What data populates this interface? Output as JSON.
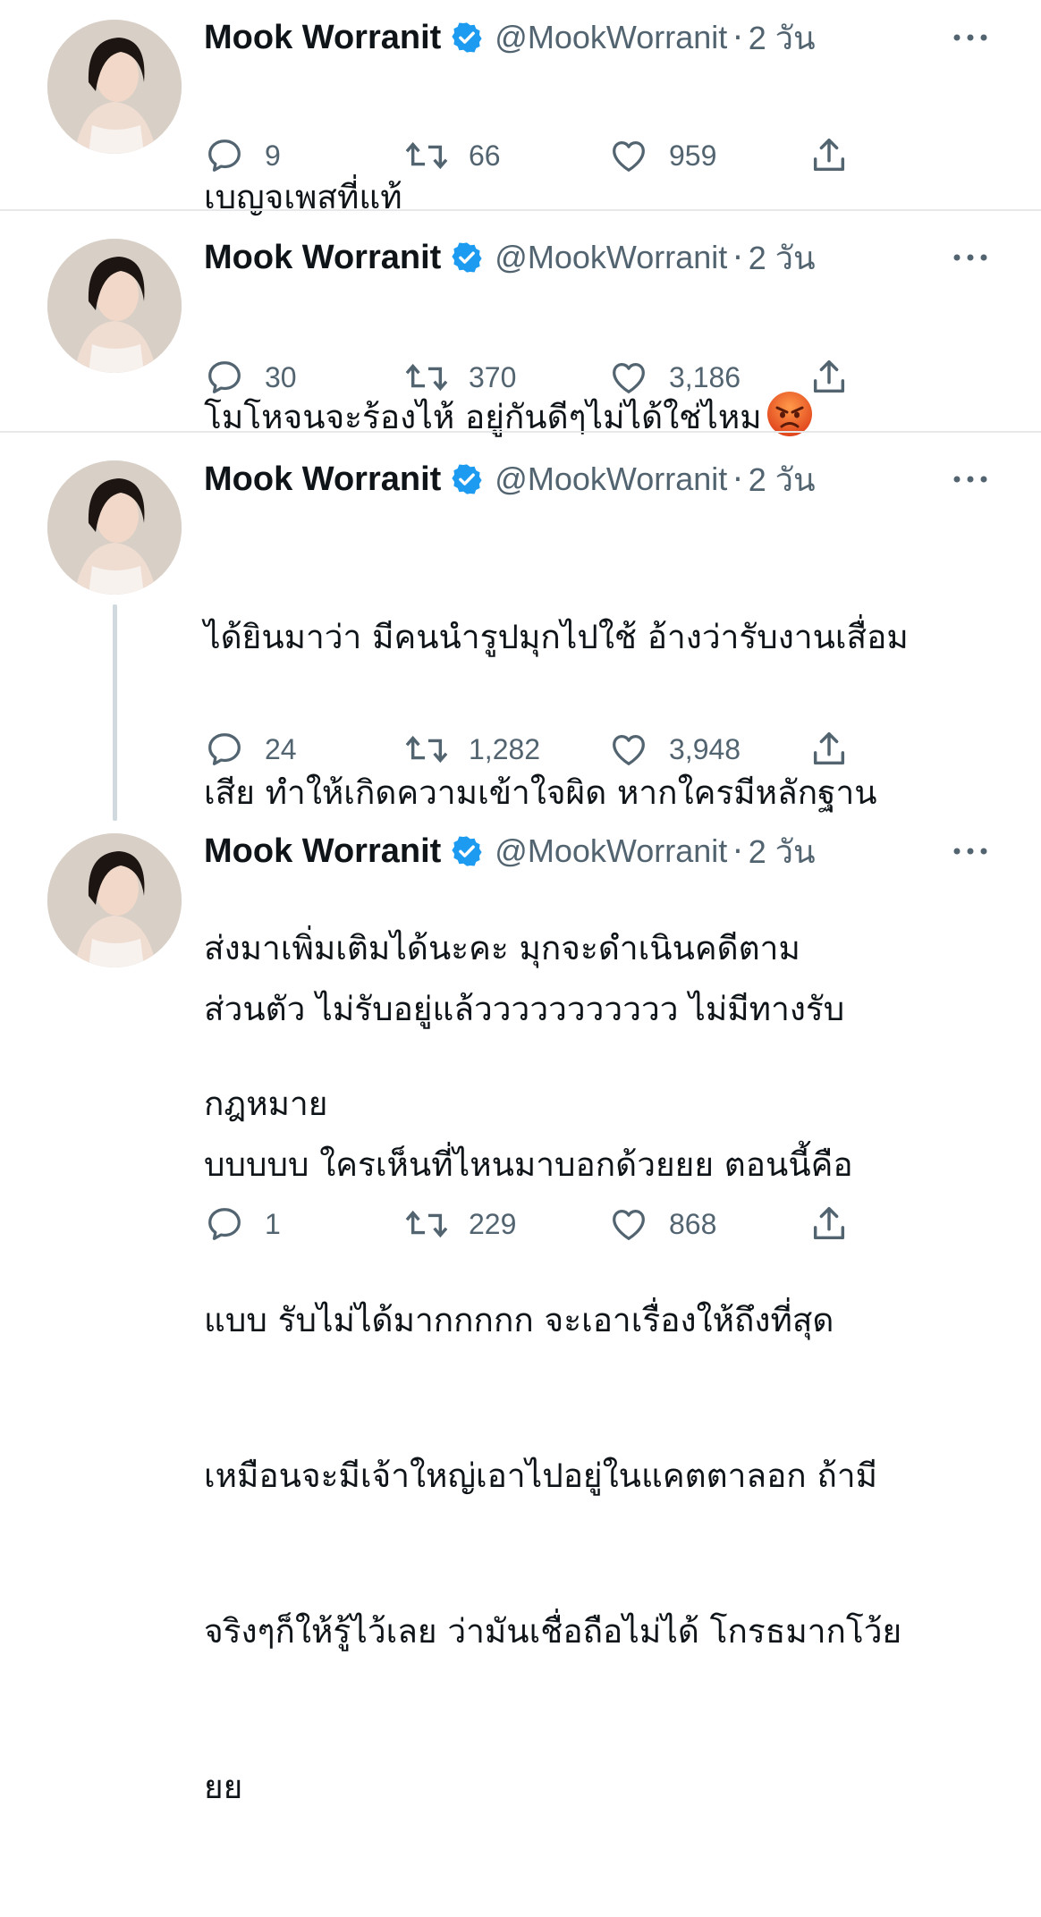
{
  "tweets": [
    {
      "name": "Mook Worranit",
      "handle": "@MookWorranit",
      "dot": "·",
      "time": "2 วัน",
      "lines": [
        "เบญจเพสที่แท้"
      ],
      "emoji": "",
      "replies": "9",
      "retweets": "66",
      "likes": "959"
    },
    {
      "name": "Mook Worranit",
      "handle": "@MookWorranit",
      "dot": "·",
      "time": "2 วัน",
      "lines": [
        "โมโหจนจะร้องไห้ อยู่กันดีๆไม่ได้ใช่ไหม"
      ],
      "emoji": "angry-face-emoji",
      "replies": "30",
      "retweets": "370",
      "likes": "3,186"
    },
    {
      "name": "Mook Worranit",
      "handle": "@MookWorranit",
      "dot": "·",
      "time": "2 วัน",
      "lines": [
        "ได้ยินมาว่า มีคนนำรูปมุกไปใช้ อ้างว่ารับงานเสื่อม",
        "เสีย ทำให้เกิดความเข้าใจผิด หากใครมีหลักฐาน",
        "ส่งมาเพิ่มเติมได้นะคะ มุกจะดำเนินคดีตาม",
        "กฎหมาย"
      ],
      "emoji": "",
      "replies": "24",
      "retweets": "1,282",
      "likes": "3,948"
    },
    {
      "name": "Mook Worranit",
      "handle": "@MookWorranit",
      "dot": "·",
      "time": "2 วัน",
      "lines": [
        "ส่วนตัว ไม่รับอยู่แล้ววววววววววว ไม่มีทางรับ",
        "บบบบบ ใครเห็นที่ไหนมาบอกด้วยยย ตอนนี้คือ",
        "แบบ รับไม่ได้มากกกกก จะเอาเรื่องให้ถึงที่สุด",
        "เหมือนจะมีเจ้าใหญ่เอาไปอยู่ในแคตตาลอก ถ้ามี",
        "จริงๆก็ให้รู้ไว้เลย ว่ามันเชื่อถือไม่ได้ โกรธมากโว้ย",
        "ยย"
      ],
      "emoji": "",
      "replies": "1",
      "retweets": "229",
      "likes": "868"
    }
  ],
  "colors": {
    "text": "#0f1419",
    "secondary": "#536471",
    "verified": "#1d9bf0",
    "divider": "#e6e8ea",
    "thread_line": "#cfd9de"
  },
  "icons": [
    "reply-icon",
    "retweet-icon",
    "like-icon",
    "share-icon",
    "verified-badge-icon",
    "more-icon"
  ]
}
